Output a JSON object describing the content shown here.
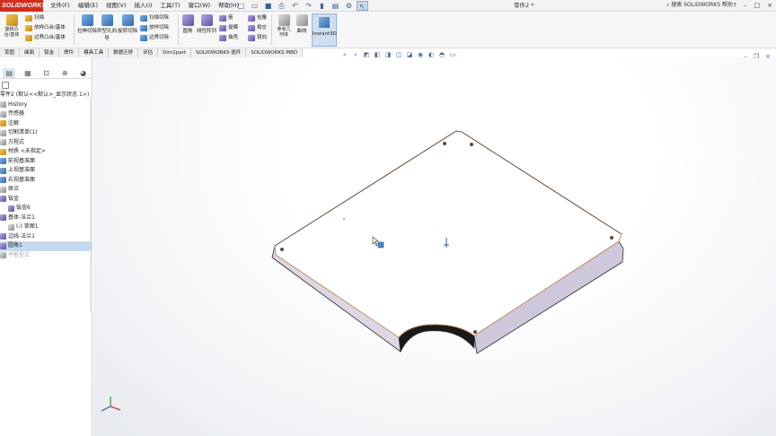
{
  "app": {
    "logo_text": "SOLIDWORKS",
    "document_title": "零件2 *",
    "search_text": "搜索 SOLIDWORKS 帮助",
    "brand_color": "#d52b1e"
  },
  "menu": {
    "items": [
      "文件(F)",
      "编辑(E)",
      "视图(V)",
      "插入(I)",
      "工具(T)",
      "窗口(W)",
      "帮助(H)"
    ]
  },
  "quick_access": {
    "icons": [
      "new-icon",
      "open-icon",
      "save-icon",
      "print-icon",
      "undo-icon",
      "redo-icon",
      "rebuild-icon",
      "file-properties-icon",
      "options-icon",
      "select-icon"
    ]
  },
  "window_controls": [
    "?",
    "–",
    "□",
    "×"
  ],
  "ribbon": {
    "rotate_boss": "旋转凸台/基体",
    "sweep": "扫描",
    "revolve_boss": "旋转凸台/基体",
    "loft": "放样凸台/基体",
    "boundary_boss": "边界凸台/基体",
    "extruded_cut": "拉伸切除",
    "hole_wizard": "异型孔向导",
    "revolved_cut": "旋转切除",
    "swept_cut": "扫描切除",
    "lofted_cut": "放样切除",
    "boundary_cut": "边界切除",
    "fillet": "圆角",
    "linear_pattern": "线性阵列",
    "rib": "筋",
    "draft": "拔模",
    "shell": "抽壳",
    "wrap": "包覆",
    "intersect": "相交",
    "mirror": "镜向",
    "reference_geometry": "参考几何体",
    "curves": "曲线",
    "instant3d": "Instant3D"
  },
  "command_tabs": [
    "草图",
    "曲面",
    "钣金",
    "焊件",
    "模具工具",
    "数据迁移",
    "评估",
    "Dim1part",
    "SOLIDWORKS 插件",
    "SOLIDWORKS MBD"
  ],
  "feature_manager": {
    "tab_icons": [
      "featuremanager-icon",
      "propertymanager-icon",
      "configurationmanager-icon",
      "dimxpert-icon",
      "display-manager-icon"
    ],
    "tree": [
      {
        "label": "零件2 (默认<<默认>_显示状态 1>)",
        "icon": "part-icon",
        "indent": 0
      },
      {
        "label": "History",
        "icon": "history-icon",
        "indent": 1
      },
      {
        "label": "传感器",
        "icon": "sensor-icon",
        "indent": 1
      },
      {
        "label": "注解",
        "icon": "annotations-icon",
        "indent": 1
      },
      {
        "label": "切割清单(1)",
        "icon": "cut-list-icon",
        "indent": 1
      },
      {
        "label": "方程式",
        "icon": "equations-icon",
        "indent": 1
      },
      {
        "label": "材质 <未指定>",
        "icon": "material-icon",
        "indent": 1
      },
      {
        "label": "前视基准面",
        "icon": "plane-icon",
        "indent": 1
      },
      {
        "label": "上视基准面",
        "icon": "plane-icon",
        "indent": 1
      },
      {
        "label": "右视基准面",
        "icon": "plane-icon",
        "indent": 1
      },
      {
        "label": "原点",
        "icon": "origin-icon",
        "indent": 1
      },
      {
        "label": "钣金",
        "icon": "sheetmetal-icon",
        "indent": 1
      },
      {
        "label": "钣金6",
        "icon": "sheetmetal-icon",
        "indent": 2
      },
      {
        "label": "基体-法兰1",
        "icon": "base-flange-icon",
        "indent": 1
      },
      {
        "label": "(-) 草图1",
        "icon": "sketch-icon",
        "indent": 2
      },
      {
        "label": "边线-法兰1",
        "icon": "edge-flange-icon",
        "indent": 1
      },
      {
        "label": "圆角1",
        "icon": "fillet-icon",
        "indent": 1,
        "selected": true
      },
      {
        "label": "平板型式",
        "icon": "flat-pattern-icon",
        "indent": 1,
        "dim": true
      }
    ]
  },
  "viewport": {
    "background_color": "#f3f5f8",
    "model_top_color": "#ffffff",
    "model_side_color": "#d9d4e3",
    "edge_color": "#2b2b2b",
    "highlight_color": "#c89060"
  }
}
